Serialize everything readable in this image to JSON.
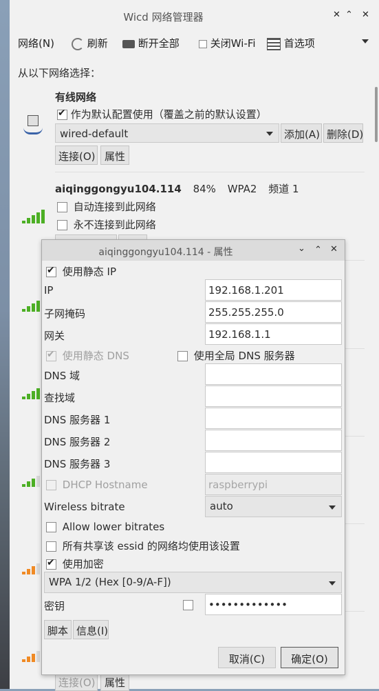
{
  "window": {
    "title": "Wicd 网络管理器"
  },
  "toolbar": {
    "network": "网络(N)",
    "refresh": "刷新",
    "disconnect_all": "断开全部",
    "disable_wifi": "关闭Wi-Fi",
    "preferences": "首选项"
  },
  "choose_label": "从以下网络选择：",
  "wired": {
    "title": "有线网络",
    "default_label": "作为默认配置使用（覆盖之前的默认设置）",
    "profile": "wired-default",
    "add": "添加(A)",
    "delete": "删除(D)",
    "connect": "连接(O)",
    "properties": "属性"
  },
  "wifi": {
    "ssid": "aiqinggongyu104.114",
    "strength": "84%",
    "encryption": "WPA2",
    "channel": "频道 1",
    "auto_connect": "自动连接到此网络",
    "never_connect": "永不连接到此网络"
  },
  "bottom": {
    "connect": "连接(O)",
    "properties": "属性"
  },
  "dialog": {
    "title": "aiqinggongyu104.114 - 属性",
    "use_static_ip": "使用静态 IP",
    "ip_label": "IP",
    "ip": "192.168.1.201",
    "netmask_label": "子网掩码",
    "netmask": "255.255.255.0",
    "gateway_label": "网关",
    "gateway": "192.168.1.1",
    "use_static_dns": "使用静态 DNS",
    "use_global_dns": "使用全局 DNS 服务器",
    "dns_domain": "DNS 域",
    "search_domain": "查找域",
    "dns1": "DNS 服务器 1",
    "dns2": "DNS 服务器 2",
    "dns3": "DNS 服务器 3",
    "dhcp_hostname": "DHCP Hostname",
    "hostname_placeholder": "raspberrypi",
    "bitrate_label": "Wireless bitrate",
    "bitrate": "auto",
    "allow_lower": "Allow lower bitrates",
    "share_settings": "所有共享该 essid 的网络均使用该设置",
    "use_encryption": "使用加密",
    "encryption_type": "WPA 1/2 (Hex [0-9/A-F])",
    "key_label": "密钥",
    "key": "•••••••••••••",
    "script": "脚本",
    "info": "信息(I)",
    "cancel": "取消(C)",
    "ok": "确定(O)"
  }
}
